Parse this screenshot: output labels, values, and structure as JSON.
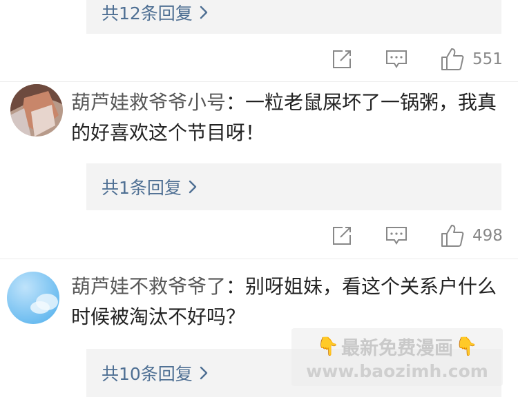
{
  "thread1": {
    "reply_link": "共12条回复",
    "like_count": "551"
  },
  "comment1": {
    "username": "葫芦娃救爷爷小号",
    "separator": "：",
    "text": "一粒老鼠屎坏了一锅粥，我真的好喜欢这个节目呀！",
    "reply_link": "共1条回复",
    "like_count": "498"
  },
  "comment2": {
    "username": "葫芦娃不救爷爷了",
    "separator": "：",
    "text": "别呀姐妹，看这个关系户什么时候被淘汰不好吗？",
    "reply_link": "共10条回复"
  },
  "icons": {
    "edit": "edit-icon",
    "comment": "comment-icon",
    "like": "thumbs-up-icon",
    "chevron": "chevron-right-icon",
    "pointing_hand": "pointing-down-icon"
  },
  "watermark": {
    "line1": "最新免费漫画",
    "line2": "www.baozimh.com"
  },
  "colors": {
    "link": "#4e6f93",
    "reply_bg": "#f3f3f3",
    "text": "#222222",
    "username": "#575757",
    "icon": "#888888"
  }
}
